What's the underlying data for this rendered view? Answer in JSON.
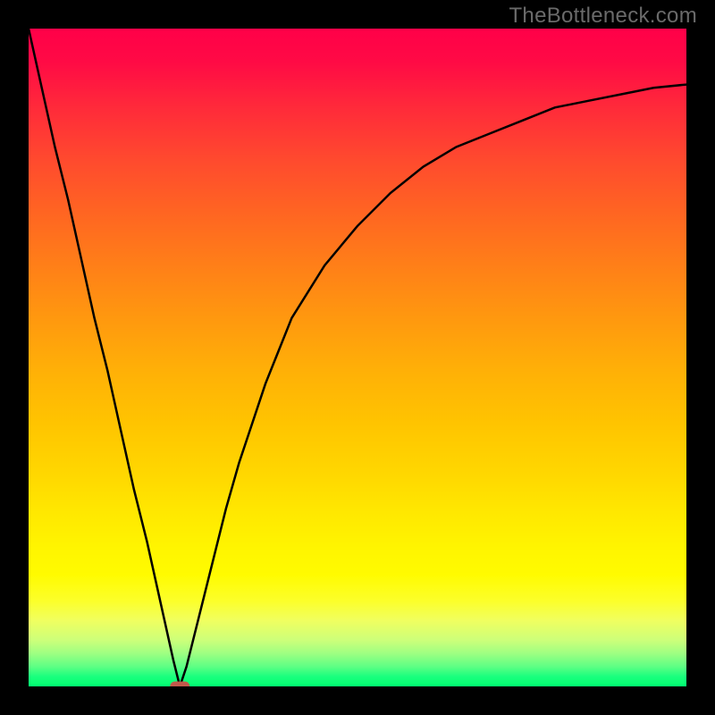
{
  "watermark": "TheBottleneck.com",
  "colors": {
    "background": "#000000",
    "curve": "#000000",
    "marker": "#c1594b",
    "gradient_top": "#ff0048",
    "gradient_bottom": "#00ff70"
  },
  "chart_data": {
    "type": "line",
    "title": "",
    "xlabel": "",
    "ylabel": "",
    "xlim": [
      0,
      100
    ],
    "ylim": [
      0,
      100
    ],
    "x": [
      0,
      2,
      4,
      6,
      8,
      10,
      12,
      14,
      16,
      18,
      20,
      22,
      23,
      24,
      26,
      28,
      30,
      32,
      34,
      36,
      38,
      40,
      45,
      50,
      55,
      60,
      65,
      70,
      75,
      80,
      85,
      90,
      95,
      100
    ],
    "values": [
      100,
      91,
      82,
      74,
      65,
      56,
      48,
      39,
      30,
      22,
      13,
      4,
      0,
      3,
      11,
      19,
      27,
      34,
      40,
      46,
      51,
      56,
      64,
      70,
      75,
      79,
      82,
      84,
      86,
      88,
      89,
      90,
      91,
      91.5
    ],
    "annotations": [
      {
        "type": "marker",
        "x": 23,
        "y": 0,
        "shape": "pill",
        "color": "#c1594b"
      }
    ],
    "grid": false,
    "legend": false
  }
}
